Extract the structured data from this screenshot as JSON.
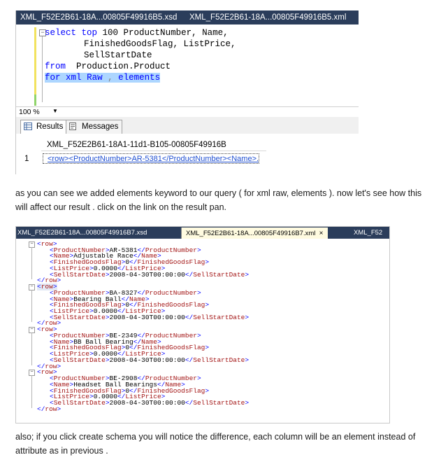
{
  "screenshot1": {
    "tabs": [
      "XML_F52E2B61-18A...00805F49916B5.xsd",
      "XML_F52E2B61-18A...00805F49916B5.xml"
    ],
    "code": {
      "line1": {
        "kw1": "select",
        "kw2": "top",
        "rest": " 100 ProductNumber, Name,"
      },
      "line2": "FinishedGoodsFlag, ListPrice,",
      "line3": "SellStartDate",
      "line4": {
        "kw": "from",
        "rest": "  Production.Product"
      },
      "line5": {
        "kw1": "for",
        "kw2": "xml",
        "kw3": "Raw",
        "comma": " ,",
        "kw4": "elements"
      }
    },
    "zoom": "100 %",
    "results_tabs": [
      "Results",
      "Messages"
    ],
    "grid": {
      "column_header": "XML_F52E2B61-18A1-11d1-B105-00805F49916B",
      "row_number": "1",
      "cell_value": "<row><ProductNumber>AR-5381</ProductNumber><Name>..."
    }
  },
  "paragraph1": "as you can see we added elements keyword to our query ( for xml raw, elements ). now let's see how this will affect our result . click on the link on the result pan.",
  "screenshot2": {
    "tabs": [
      "XML_F52E2B61-18A...00805F49916B7.xsd",
      "XML_F52E2B61-18A...00805F49916B7.xml",
      "XML_F52"
    ],
    "close_glyph": "×",
    "rows": [
      {
        "ProductNumber": "AR-5381",
        "Name": "Adjustable Race",
        "FinishedGoodsFlag": "0",
        "ListPrice": "0.0000",
        "SellStartDate": "2008-04-30T00:00:00"
      },
      {
        "ProductNumber": "BA-8327",
        "Name": "Bearing Ball",
        "FinishedGoodsFlag": "0",
        "ListPrice": "0.0000",
        "SellStartDate": "2008-04-30T00:00:00"
      },
      {
        "ProductNumber": "BE-2349",
        "Name": "BB Ball Bearing",
        "FinishedGoodsFlag": "0",
        "ListPrice": "0.0000",
        "SellStartDate": "2008-04-30T00:00:00"
      },
      {
        "ProductNumber": "BE-2908",
        "Name": "Headset Ball Bearings",
        "FinishedGoodsFlag": "0",
        "ListPrice": "0.0000",
        "SellStartDate": "2008-04-30T00:00:00"
      }
    ]
  },
  "paragraph2": "also;  if you click create schema you will notice the difference,  each column will be an element instead  of attribute as in previous ."
}
